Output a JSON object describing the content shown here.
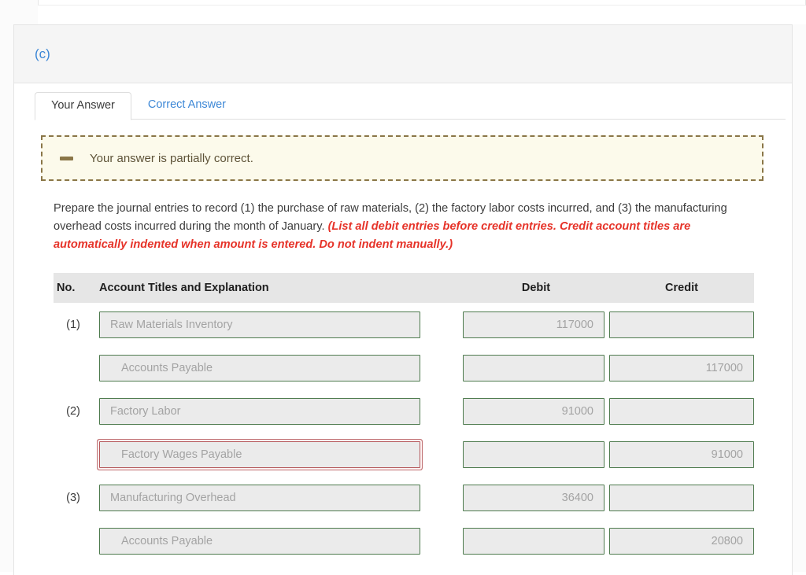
{
  "part": {
    "label": "(c)"
  },
  "tabs": [
    {
      "label": "Your Answer",
      "active": true
    },
    {
      "label": "Correct Answer",
      "active": false
    }
  ],
  "alert": {
    "icon": "minus-dash-icon",
    "message": "Your answer is partially correct.",
    "background": "#fcfaeb",
    "border_color": "#8a7647",
    "text_color": "#5e5338"
  },
  "instructions": {
    "normal_1": "Prepare the journal entries to record (1) the purchase of raw materials, (2) the factory labor costs incurred, and (3) the manufacturing overhead costs incurred during the month of January. ",
    "emphasis": "(List all debit entries before credit entries. Credit account titles are automatically indented when amount is entered. Do not indent manually.)",
    "emphasis_color": "#e63329"
  },
  "journal": {
    "headers": {
      "no": "No.",
      "account": "Account Titles and Explanation",
      "debit": "Debit",
      "credit": "Credit"
    },
    "rows": [
      {
        "no": "(1)",
        "account": "Raw Materials Inventory",
        "indent": false,
        "error": false,
        "debit": "117000",
        "credit": ""
      },
      {
        "no": "",
        "account": "Accounts Payable",
        "indent": true,
        "error": false,
        "debit": "",
        "credit": "117000"
      },
      {
        "no": "(2)",
        "account": "Factory Labor",
        "indent": false,
        "error": false,
        "debit": "91000",
        "credit": ""
      },
      {
        "no": "",
        "account": "Factory Wages Payable",
        "indent": true,
        "error": true,
        "debit": "",
        "credit": "91000"
      },
      {
        "no": "(3)",
        "account": "Manufacturing Overhead",
        "indent": false,
        "error": false,
        "debit": "36400",
        "credit": ""
      },
      {
        "no": "",
        "account": "Accounts Payable",
        "indent": true,
        "error": false,
        "debit": "",
        "credit": "20800"
      }
    ],
    "field_border_color": "#4d7a4d",
    "field_error_border_color": "#b5595c",
    "field_background": "#ebebeb",
    "header_background": "#e6e6e6"
  }
}
